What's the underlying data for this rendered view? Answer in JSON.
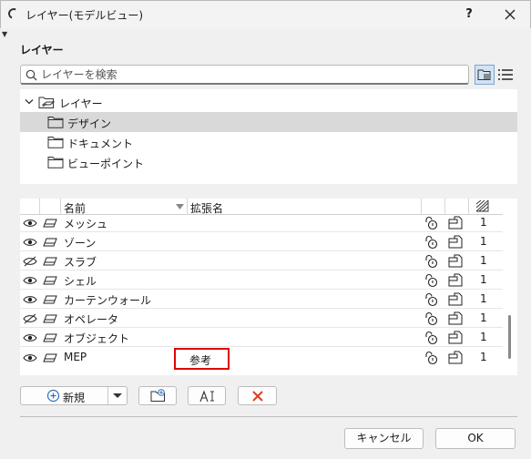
{
  "window": {
    "title": "レイヤー(モデルビュー)",
    "help": "?"
  },
  "section": {
    "title": "レイヤー"
  },
  "search": {
    "placeholder": "レイヤーを検索"
  },
  "tree": {
    "root": "レイヤー",
    "children": [
      "デザイン",
      "ドキュメント",
      "ビューポイント"
    ],
    "selected": "デザイン"
  },
  "table": {
    "columns": {
      "name": "名前",
      "extension": "拡張名"
    },
    "rows": [
      {
        "name": "メッシュ",
        "value": "1",
        "visible": true
      },
      {
        "name": "ゾーン",
        "value": "1",
        "visible": true
      },
      {
        "name": "スラブ",
        "value": "1",
        "visible": false
      },
      {
        "name": "シェル",
        "value": "1",
        "visible": true
      },
      {
        "name": "カーテンウォール",
        "value": "1",
        "visible": true
      },
      {
        "name": "オペレータ",
        "value": "1",
        "visible": false
      },
      {
        "name": "オブジェクト",
        "value": "1",
        "visible": true
      },
      {
        "name": "MEP",
        "value": "1",
        "visible": true,
        "extension": "参考"
      }
    ]
  },
  "buttons": {
    "new": "新規",
    "cancel": "キャンセル",
    "ok": "OK"
  },
  "colors": {
    "accent": "#2f6fb8",
    "selection": "#d9d9d9",
    "highlight": "#e00000",
    "delete": "#e23b1f"
  },
  "icons": [
    "refresh-icon",
    "help-icon",
    "close-icon",
    "search-icon",
    "folder-tree-view-icon",
    "list-view-icon",
    "chevron-down-icon",
    "layer-stack-icon",
    "folder-icon",
    "eye-icon",
    "eye-hidden-icon",
    "eraser-icon",
    "lock-icon",
    "wireframe-icon",
    "plus-circle-icon",
    "new-folder-icon",
    "rename-icon",
    "delete-icon"
  ]
}
